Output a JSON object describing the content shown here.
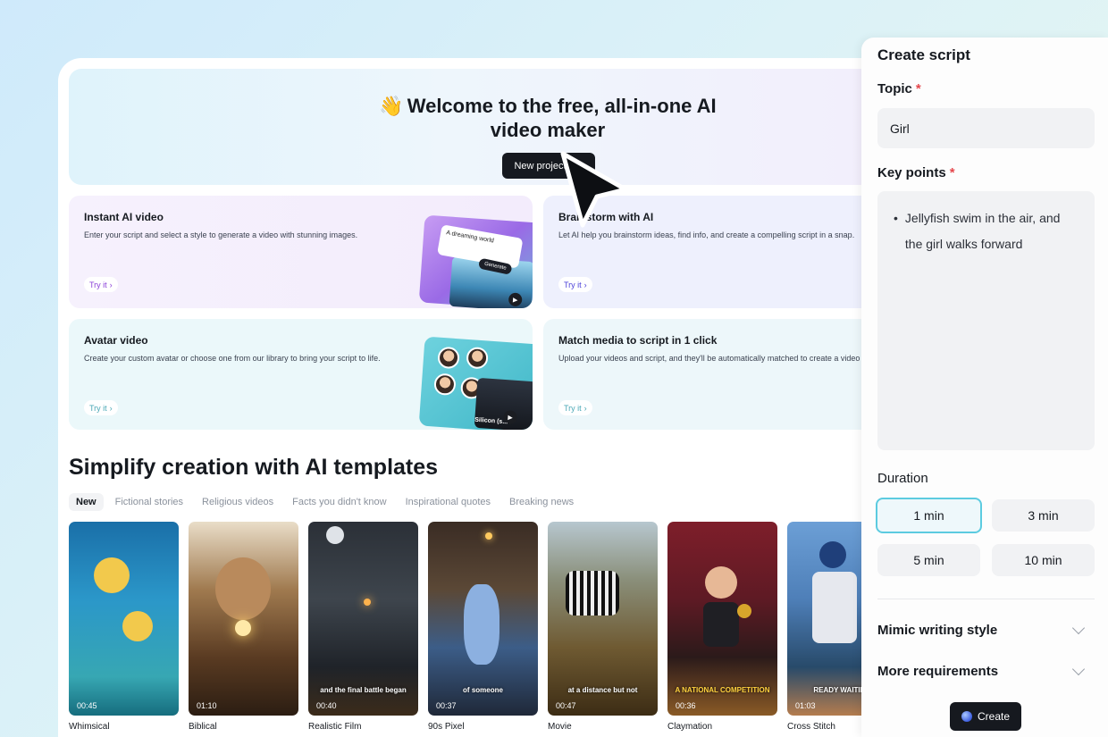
{
  "hero": {
    "wave_emoji": "👋",
    "title_line1": "Welcome to the free, all-in-one AI",
    "title_line2": "video maker",
    "new_project_label": "New project",
    "arrow": "→"
  },
  "cards": [
    {
      "title": "Instant AI video",
      "desc": "Enter your script and select a style to generate a video with stunning images.",
      "try": "Try it",
      "illus_bubble": "A dreaming world",
      "illus_button": "Generate"
    },
    {
      "title": "Brainstorm with AI",
      "desc": "Let AI help you brainstorm ideas, find info, and create a compelling script in a snap.",
      "try": "Try it"
    },
    {
      "title": "Avatar video",
      "desc": "Create your custom avatar or choose one from our library to bring your script to life.",
      "try": "Try it",
      "illus_caption": "Silicon (s..."
    },
    {
      "title": "Match media to script in 1 click",
      "desc": "Upload your videos and script, and they'll be automatically matched to create a video",
      "try": "Try it"
    }
  ],
  "templates_section": {
    "title": "Simplify creation with AI templates",
    "filters": [
      "New",
      "Fictional stories",
      "Religious videos",
      "Facts you didn't know",
      "Inspirational quotes",
      "Breaking news"
    ],
    "active_filter": "New",
    "items": [
      {
        "label": "Whimsical",
        "duration": "00:45",
        "subtitle": ""
      },
      {
        "label": "Biblical",
        "duration": "01:10",
        "subtitle": ""
      },
      {
        "label": "Realistic Film",
        "duration": "00:40",
        "subtitle": "and the final battle began"
      },
      {
        "label": "90s Pixel",
        "duration": "00:37",
        "subtitle": "of someone"
      },
      {
        "label": "Movie",
        "duration": "00:47",
        "subtitle": "at a distance but not"
      },
      {
        "label": "Claymation",
        "duration": "00:36",
        "subtitle": "A NATIONAL COMPETITION"
      },
      {
        "label": "Cross Stitch",
        "duration": "01:03",
        "subtitle": "READY WAITING"
      }
    ]
  },
  "create_script": {
    "title": "Create script",
    "topic_label": "Topic",
    "required_mark": "*",
    "topic_value": "Girl",
    "key_points_label": "Key points",
    "key_points": [
      "Jellyfish swim in the air, and the girl walks forward"
    ],
    "duration_label": "Duration",
    "durations": [
      "1 min",
      "3 min",
      "5 min",
      "10 min"
    ],
    "selected_duration": "1 min",
    "mimic_label": "Mimic writing style",
    "more_label": "More requirements",
    "create_label": "Create"
  },
  "colors": {
    "accent": "#5ccbe0",
    "dark_button": "#16191f",
    "required": "#e5484d"
  }
}
